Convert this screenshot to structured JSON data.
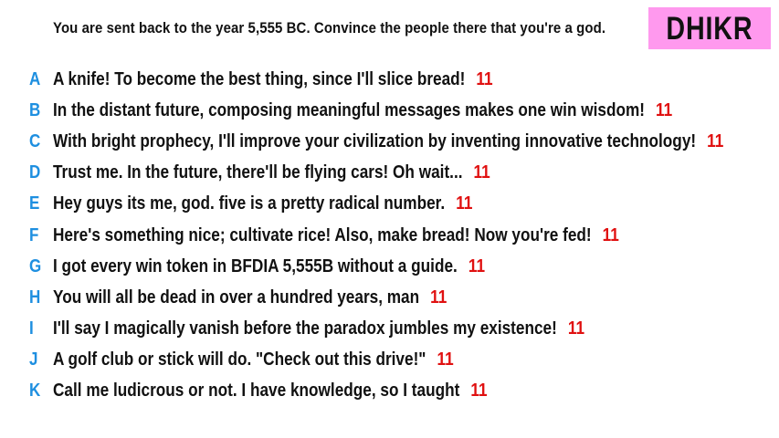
{
  "prompt": "You are sent back to the year 5,555 BC. Convince the people there that you're a god.",
  "badge": {
    "label": "DHIKR",
    "color": "#ff99ee"
  },
  "colors": {
    "letter": "#1e8fe0",
    "score": "#e01010",
    "text": "#111111"
  },
  "answers": [
    {
      "letter": "A",
      "text": "A knife! To become the best thing, since I'll slice bread!",
      "score": "11"
    },
    {
      "letter": "B",
      "text": "In the distant future, composing meaningful messages makes one win wisdom!",
      "score": "11"
    },
    {
      "letter": "C",
      "text": "With bright prophecy, I'll improve your civilization by inventing innovative technology!",
      "score": "11"
    },
    {
      "letter": "D",
      "text": "Trust me. In the future, there'll be flying cars! Oh wait...",
      "score": "11"
    },
    {
      "letter": "E",
      "text": "Hey guys its me, god. five is a pretty radical number.",
      "score": "11"
    },
    {
      "letter": "F",
      "text": "Here's something nice; cultivate rice! Also, make bread! Now you're fed!",
      "score": "11"
    },
    {
      "letter": "G",
      "text": "I got every win token in BFDIA 5,555B without a guide.",
      "score": "11"
    },
    {
      "letter": "H",
      "text": "You will all be dead in over a hundred years, man",
      "score": "11"
    },
    {
      "letter": "I",
      "text": "I'll say I magically vanish before the paradox jumbles my existence!",
      "score": "11"
    },
    {
      "letter": "J",
      "text": "A golf club or stick will do. \"Check out this drive!\"",
      "score": "11"
    },
    {
      "letter": "K",
      "text": "Call me ludicrous or not. I have knowledge, so I taught",
      "score": "11"
    }
  ]
}
